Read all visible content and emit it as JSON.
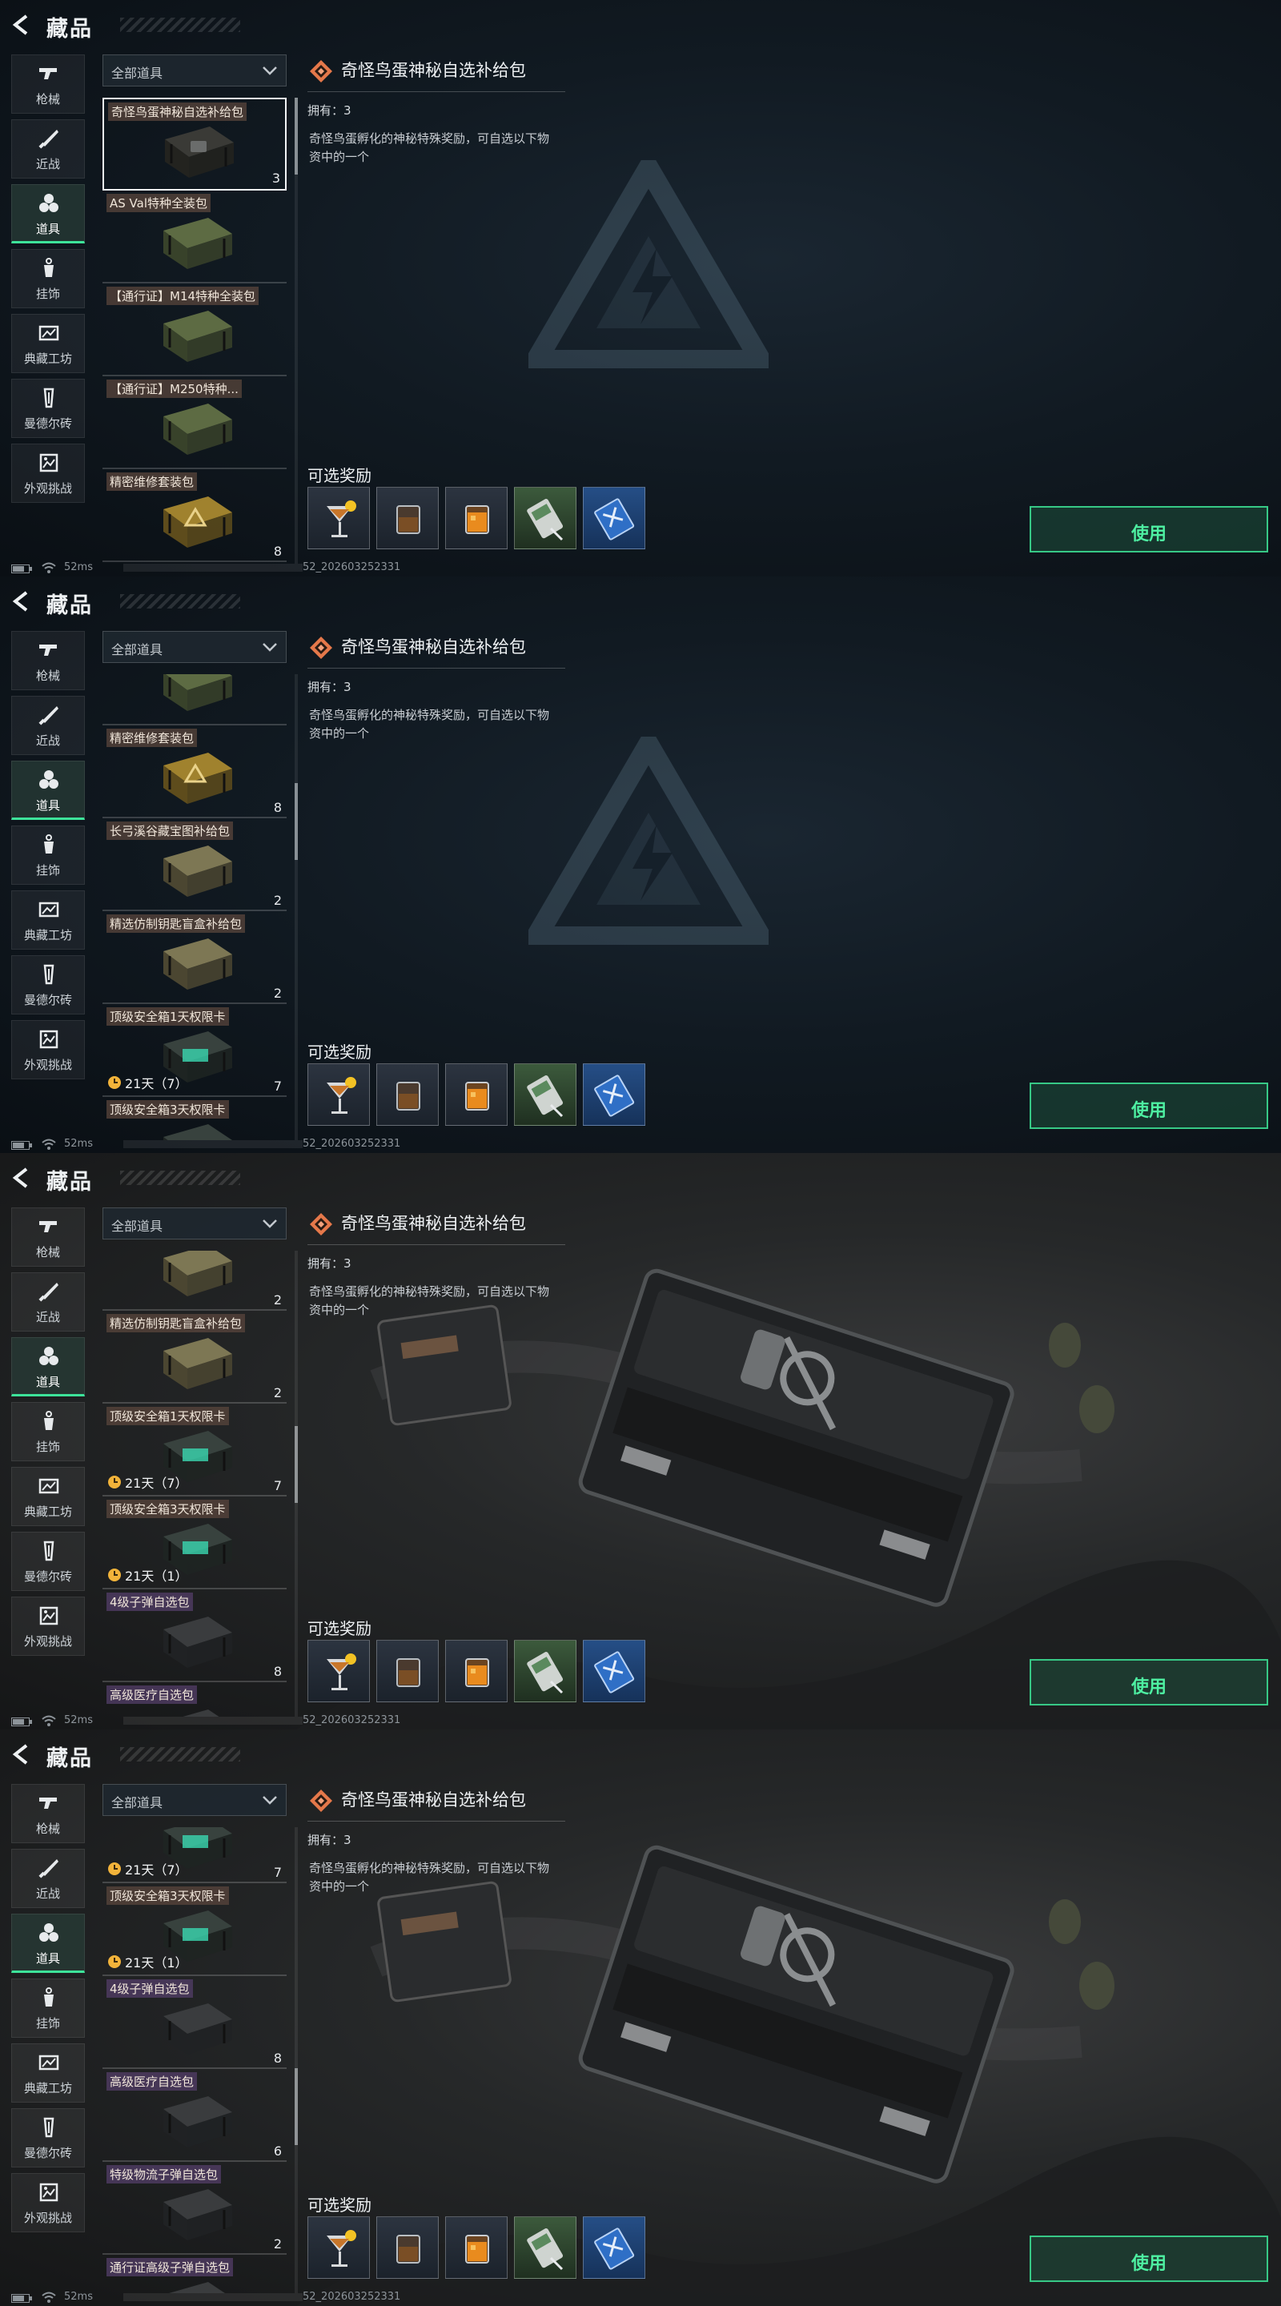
{
  "colors": {
    "accent": "#3de39a",
    "use_button": "#37c986",
    "name_tag": "#5a463c"
  },
  "header": {
    "title": "藏品"
  },
  "nav": [
    {
      "label": "枪械",
      "icon": "gun-icon"
    },
    {
      "label": "近战",
      "icon": "knife-icon"
    },
    {
      "label": "道具",
      "icon": "items-icon",
      "active": true
    },
    {
      "label": "挂饰",
      "icon": "charm-icon"
    },
    {
      "label": "典藏工坊",
      "icon": "workshop-icon"
    },
    {
      "label": "曼德尔砖",
      "icon": "brick-icon"
    },
    {
      "label": "外观挑战",
      "icon": "appearance-icon"
    }
  ],
  "filter": {
    "label": "全部道具"
  },
  "items": [
    {
      "name": "奇怪鸟蛋神秘自选补给包",
      "count": "3",
      "selected": true,
      "thumb": "dark"
    },
    {
      "name": "AS Val特种全装包",
      "count": "",
      "thumb": "green"
    },
    {
      "name": "【通行证】M14特种全装包",
      "count": "",
      "thumb": "green"
    },
    {
      "name": "【通行证】M250特种...",
      "count": "",
      "thumb": "green"
    },
    {
      "name": "精密维修套装包",
      "count": "8",
      "thumb": "yellow"
    },
    {
      "name": "长弓溪谷藏宝图补给包",
      "count": "2",
      "thumb": "olive"
    },
    {
      "name": "精选仿制钥匙盲盒补给包",
      "count": "2",
      "thumb": "olive"
    },
    {
      "name": "顶级安全箱1天权限卡",
      "count": "7",
      "timer": "21天（7）",
      "thumb": "safe"
    },
    {
      "name": "顶级安全箱3天权限卡",
      "count": "",
      "timer": "21天（1）",
      "thumb": "safe"
    },
    {
      "name": "4级子弹自选包",
      "count": "8",
      "purple": true,
      "thumb": "black"
    },
    {
      "name": "高级医疗自选包",
      "count": "6",
      "purple": true,
      "thumb": "black"
    },
    {
      "name": "特级物流子弹自选包",
      "count": "2",
      "purple": true,
      "thumb": "black"
    },
    {
      "name": "通行证高级子弹自选包",
      "count": "",
      "purple": true,
      "thumb": "black"
    }
  ],
  "detail": {
    "title": "奇怪鸟蛋神秘自选补给包",
    "owned": "拥有：3",
    "description": "奇怪鸟蛋孵化的神秘特殊奖励，可自选以下物资中的一个",
    "rewards_title": "可选奖励",
    "rewards": [
      {
        "icon": "cocktail-icon",
        "tone": "dark"
      },
      {
        "icon": "whiskey-glass-icon",
        "tone": "dark"
      },
      {
        "icon": "orange-drink-icon",
        "tone": "dark"
      },
      {
        "icon": "gift-card-icon",
        "tone": "green"
      },
      {
        "icon": "blue-ticket-icon",
        "tone": "blue"
      }
    ],
    "use_label": "使用"
  },
  "status": {
    "ping": "52ms",
    "build": "52_202603252331"
  },
  "panels": [
    {
      "scroll_offset_items": 0,
      "scroll_fraction": 0.0,
      "scene": "logo"
    },
    {
      "scroll_offset_items": 3.45,
      "scroll_fraction": 0.28,
      "scene": "logo"
    },
    {
      "scroll_offset_items": 5.35,
      "scroll_fraction": 0.45,
      "scene": "crate"
    },
    {
      "scroll_offset_items": 7.4,
      "scroll_fraction": 0.62,
      "scene": "crate"
    }
  ]
}
